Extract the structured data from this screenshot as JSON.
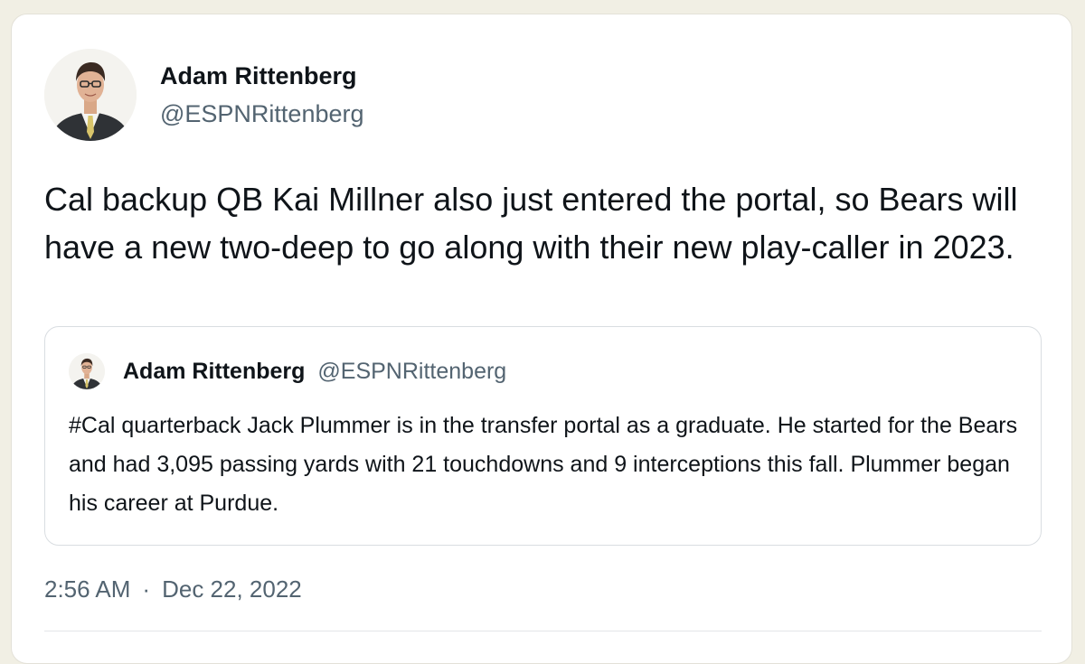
{
  "tweet": {
    "author": {
      "display_name": "Adam Rittenberg",
      "handle": "@ESPNRittenberg",
      "avatar_icon": "profile-photo-avatar"
    },
    "text": "Cal backup QB Kai Millner also just entered the portal, so Bears will have a new two-deep to go along with their new play-caller in 2023.",
    "quoted_tweet": {
      "display_name": "Adam Rittenberg",
      "handle": "@ESPNRittenberg",
      "text": "#Cal quarterback Jack Plummer is in the transfer portal as a graduate. He started for the Bears and had 3,095 passing yards with 21 touchdowns and 9 interceptions this fall. Plummer began his career at Purdue."
    },
    "time": "2:56 AM",
    "separator": "·",
    "date": "Dec 22, 2022"
  },
  "colors": {
    "page_background": "#f1efe4",
    "card_background": "#ffffff",
    "primary_text": "#0f1419",
    "secondary_text": "#536471",
    "quote_border": "#d9dde1"
  }
}
